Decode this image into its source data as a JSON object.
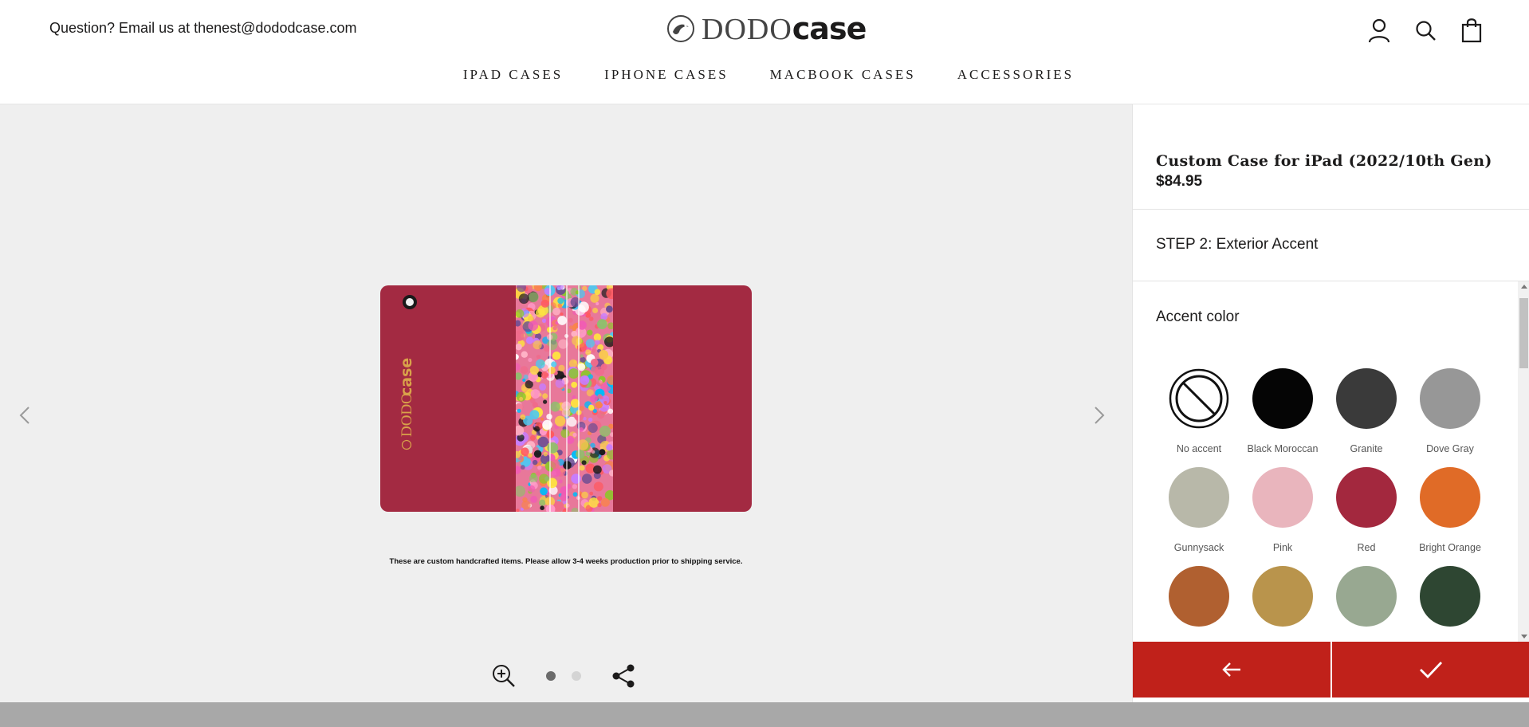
{
  "header": {
    "help_text": "Question? Email us at thenest@dododcase.com",
    "logo": {
      "thin": "DODO",
      "bold": "case"
    },
    "icons": [
      "account-icon",
      "search-icon",
      "cart-icon"
    ]
  },
  "nav": {
    "items": [
      "IPAD CASES",
      "IPHONE CASES",
      "MACBOOK CASES",
      "ACCESSORIES"
    ]
  },
  "gallery": {
    "case_color": "#a32a42",
    "notice": "These are custom handcrafted items. Please allow 3-4 weeks production prior to shipping service.",
    "image_count": 2,
    "active_image": 1
  },
  "product": {
    "title": "Custom Case for iPad (2022/10th Gen)",
    "price": "$84.95"
  },
  "step": {
    "label": "STEP 2: Exterior Accent"
  },
  "accent": {
    "title": "Accent color",
    "swatches": [
      {
        "name": "No accent",
        "color": "none"
      },
      {
        "name": "Black Moroccan",
        "color": "#050505"
      },
      {
        "name": "Granite",
        "color": "#3a3a3a"
      },
      {
        "name": "Dove Gray",
        "color": "#979797"
      },
      {
        "name": "Gunnysack",
        "color": "#b8b8a9"
      },
      {
        "name": "Pink",
        "color": "#e9b5bd"
      },
      {
        "name": "Red",
        "color": "#a3283e"
      },
      {
        "name": "Bright Orange",
        "color": "#e06b27"
      },
      {
        "name": "",
        "color": "#b06030"
      },
      {
        "name": "",
        "color": "#b9944c"
      },
      {
        "name": "",
        "color": "#98a891"
      },
      {
        "name": "",
        "color": "#2e4632"
      }
    ]
  },
  "actions": {
    "back_icon": "arrow-left-icon",
    "confirm_icon": "checkmark-icon",
    "color": "#c0211a"
  }
}
